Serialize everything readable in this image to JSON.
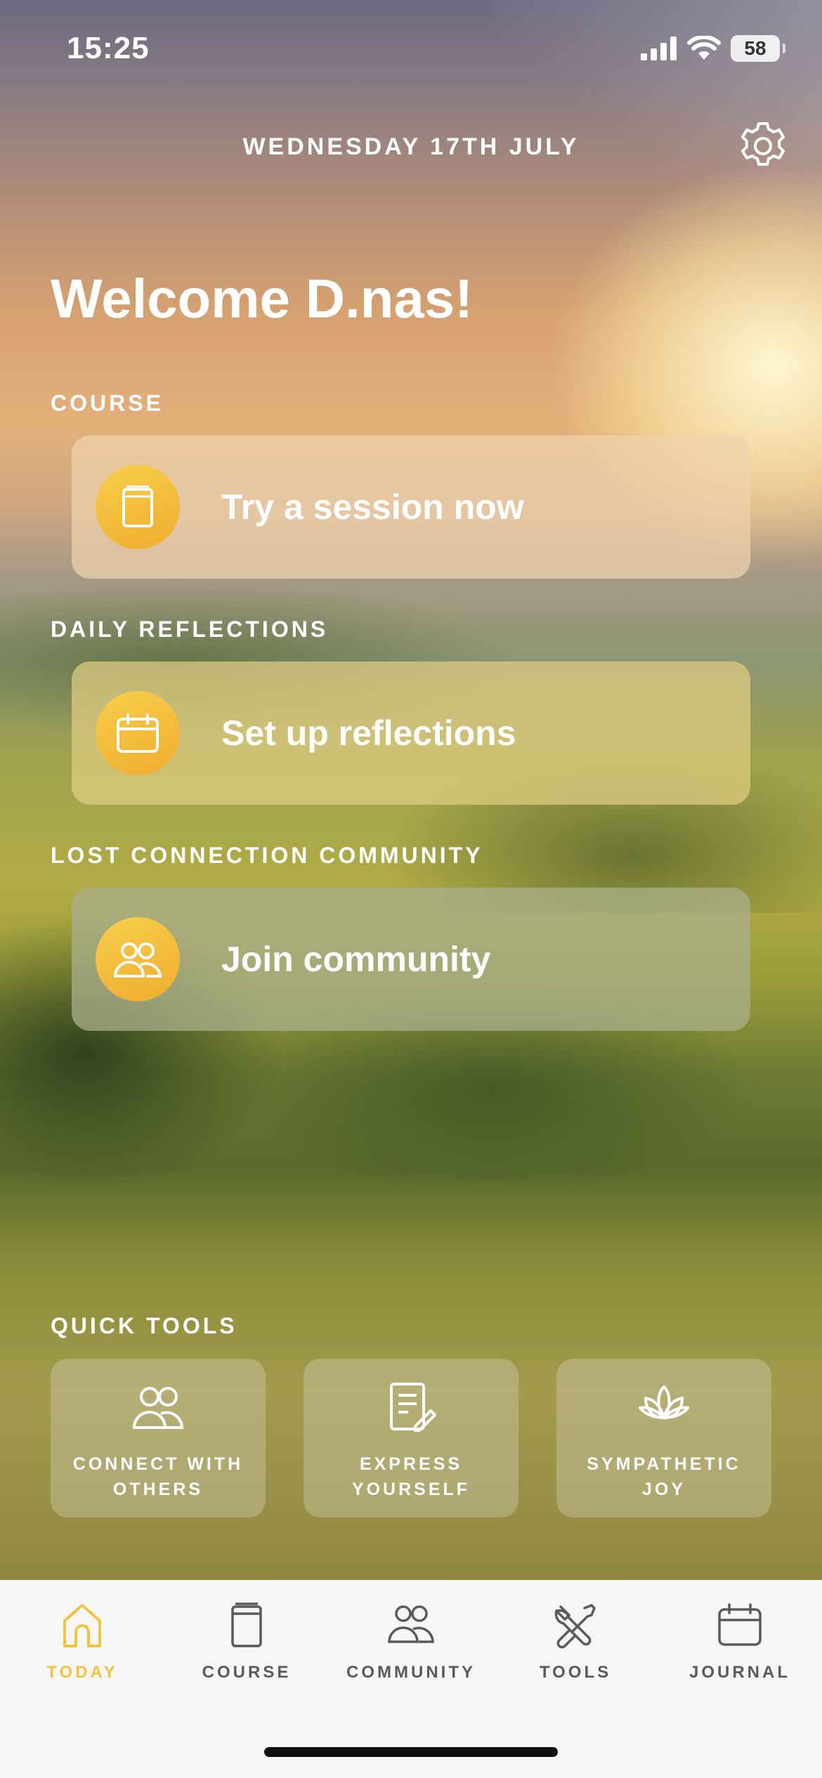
{
  "status": {
    "time": "15:25",
    "battery": "58"
  },
  "header": {
    "date": "WEDNESDAY 17TH JULY"
  },
  "welcome": "Welcome D.nas!",
  "sections": {
    "course": {
      "label": "COURSE",
      "card": "Try a session now"
    },
    "reflections": {
      "label": "DAILY REFLECTIONS",
      "card": "Set up reflections"
    },
    "community": {
      "label": "LOST CONNECTION COMMUNITY",
      "card": "Join community"
    }
  },
  "quick_tools": {
    "label": "QUICK TOOLS",
    "items": [
      {
        "line1": "CONNECT WITH",
        "line2": "OTHERS",
        "icon": "people-icon"
      },
      {
        "line1": "EXPRESS",
        "line2": "YOURSELF",
        "icon": "note-pencil-icon"
      },
      {
        "line1": "SYMPATHETIC",
        "line2": "JOY",
        "icon": "lotus-icon"
      }
    ]
  },
  "tabs": [
    {
      "label": "TODAY",
      "icon": "home-icon",
      "active": true
    },
    {
      "label": "COURSE",
      "icon": "book-icon",
      "active": false
    },
    {
      "label": "COMMUNITY",
      "icon": "people-icon",
      "active": false
    },
    {
      "label": "TOOLS",
      "icon": "tools-icon",
      "active": false
    },
    {
      "label": "JOURNAL",
      "icon": "calendar-icon",
      "active": false
    }
  ],
  "colors": {
    "accent": "#f2c33c",
    "tab_inactive": "#5a5a5a"
  }
}
